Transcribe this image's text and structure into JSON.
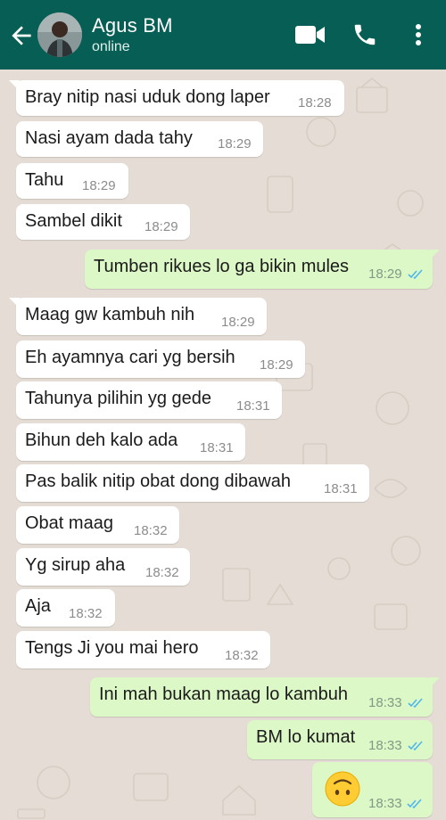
{
  "header": {
    "contact_name": "Agus BM",
    "status": "online",
    "icons": {
      "back": "arrow-back-icon",
      "video": "video-call-icon",
      "voice": "phone-call-icon",
      "menu": "more-vert-icon"
    },
    "background_color": "#075e54"
  },
  "chat": {
    "wallpaper_color": "#e5ddd5",
    "incoming_bubble_color": "#ffffff",
    "outgoing_bubble_color": "#dcf8c6",
    "read_tick_color": "#4fb6ec",
    "messages": [
      {
        "direction": "in",
        "text": "Bray nitip nasi uduk dong laper",
        "time": "18:28"
      },
      {
        "direction": "in",
        "text": "Nasi ayam dada tahy",
        "time": "18:29"
      },
      {
        "direction": "in",
        "text": "Tahu",
        "time": "18:29"
      },
      {
        "direction": "in",
        "text": "Sambel dikit",
        "time": "18:29"
      },
      {
        "direction": "out",
        "text": "Tumben rikues lo ga bikin mules",
        "time": "18:29",
        "status": "read"
      },
      {
        "direction": "in",
        "text": "Maag gw kambuh nih",
        "time": "18:29"
      },
      {
        "direction": "in",
        "text": "Eh ayamnya cari yg bersih",
        "time": "18:29"
      },
      {
        "direction": "in",
        "text": "Tahunya pilihin yg gede",
        "time": "18:31"
      },
      {
        "direction": "in",
        "text": "Bihun deh kalo ada",
        "time": "18:31"
      },
      {
        "direction": "in",
        "text": "Pas balik nitip obat dong dibawah",
        "time": "18:31"
      },
      {
        "direction": "in",
        "text": "Obat maag",
        "time": "18:32"
      },
      {
        "direction": "in",
        "text": "Yg sirup aha",
        "time": "18:32"
      },
      {
        "direction": "in",
        "text": "Aja",
        "time": "18:32"
      },
      {
        "direction": "in",
        "text": "Tengs Ji you mai hero",
        "time": "18:32"
      },
      {
        "direction": "out",
        "text": "Ini mah bukan maag lo kambuh",
        "time": "18:33",
        "status": "read"
      },
      {
        "direction": "out",
        "text": "BM lo kumat",
        "time": "18:33",
        "status": "read"
      },
      {
        "direction": "out",
        "emoji": "upside-down-face-emoji",
        "time": "18:33",
        "status": "read"
      }
    ]
  }
}
